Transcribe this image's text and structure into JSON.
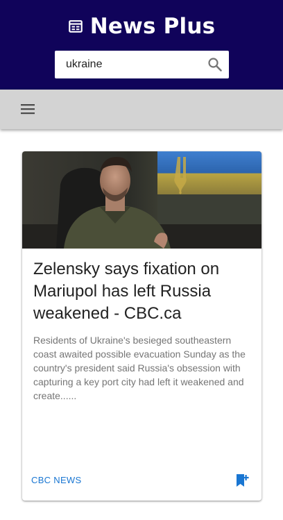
{
  "app": {
    "title": "News Plus"
  },
  "search": {
    "value": "ukraine"
  },
  "colors": {
    "header_bg": "#10035a",
    "toolbar_bg": "#d3d3d3",
    "accent": "#1976d2"
  },
  "icons": {
    "brand": "newspaper-icon",
    "search": "magnifier-icon",
    "menu": "hamburger-menu-icon",
    "bookmark": "bookmark-add-icon"
  },
  "article": {
    "title": "Zelensky says fixation on Mariupol has left Russia weakened - CBC.ca",
    "description": "Residents of Ukraine's besieged southeastern coast awaited possible evacuation Sunday as the country's president said Russia's obsession with capturing a key port city had left it weakened and create......",
    "source": "CBC NEWS"
  }
}
